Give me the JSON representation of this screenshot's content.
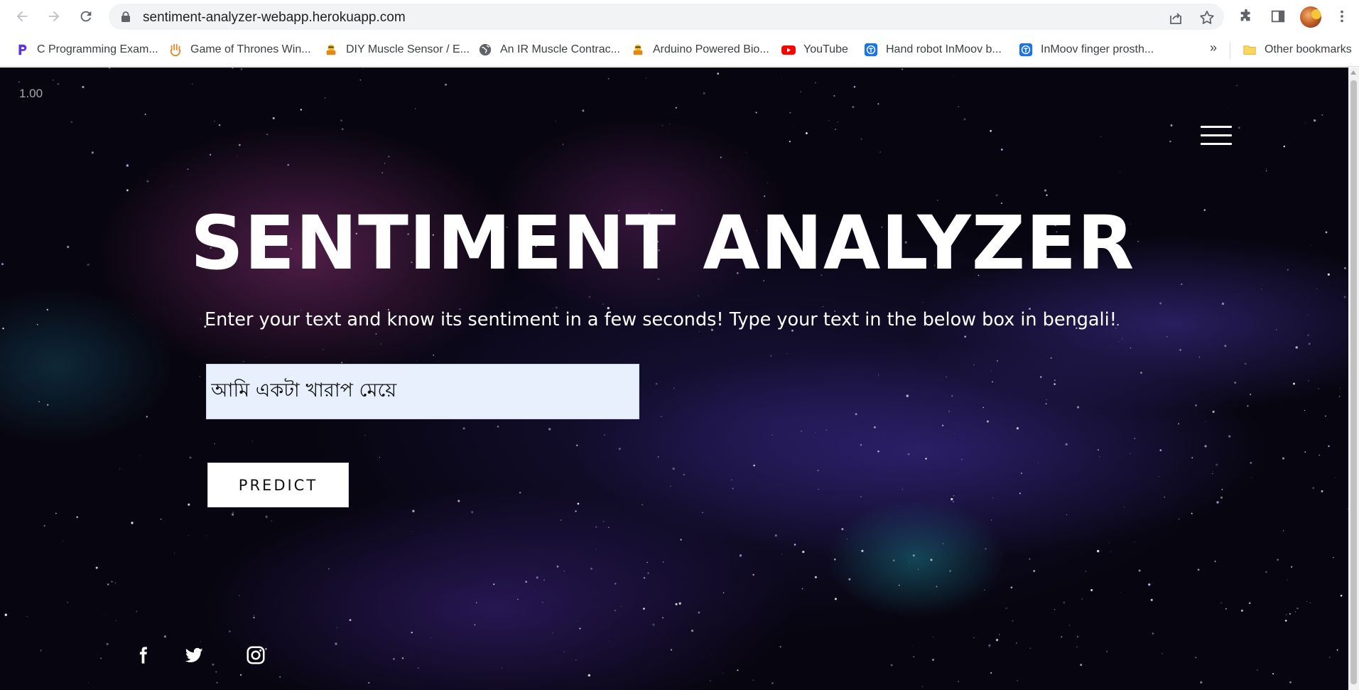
{
  "browser": {
    "url": "sentiment-analyzer-webapp.herokuapp.com",
    "bookmarks": [
      {
        "label": "C Programming Exam...",
        "icon": "programiz-icon"
      },
      {
        "label": "Game of Thrones Win...",
        "icon": "hand-icon"
      },
      {
        "label": "DIY Muscle Sensor / E...",
        "icon": "instructables-icon"
      },
      {
        "label": "An IR Muscle Contrac...",
        "icon": "globe-icon"
      },
      {
        "label": "Arduino Powered Bio...",
        "icon": "instructables-icon"
      },
      {
        "label": "YouTube",
        "icon": "youtube-icon"
      },
      {
        "label": "Hand robot InMoov b...",
        "icon": "inmoov-icon"
      },
      {
        "label": "InMoov finger prosth...",
        "icon": "inmoov-icon"
      }
    ],
    "overflow_label": "»",
    "other_bookmarks": "Other bookmarks"
  },
  "page": {
    "version": "1.00",
    "title": "SENTIMENT ANALYZER",
    "subtitle": "Enter your text and know its sentiment in a few seconds! Type your text in the below box in bengali!",
    "input_value": "আমি একটা খারাপ মেয়ে",
    "predict_label": "PREDICT",
    "social": [
      "facebook-icon",
      "twitter-icon",
      "instagram-icon"
    ]
  },
  "colors": {
    "background": "#07050f",
    "input_bg": "#e8f0fe",
    "text": "#ffffff"
  }
}
